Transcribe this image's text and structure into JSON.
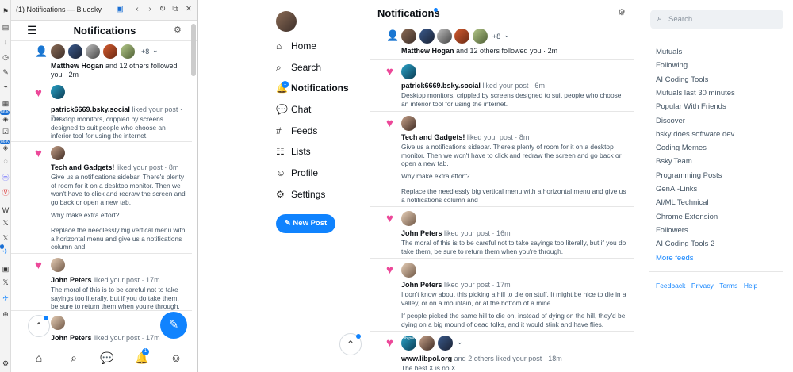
{
  "browser": {
    "tab_title": "(1) Notifications — Bluesky",
    "strip_icons": [
      "bookmark-icon",
      "book-icon",
      "download-icon",
      "clock-icon",
      "edit-icon",
      "chart-icon",
      "calendar-icon",
      "tag-icon",
      "check-icon",
      "tag-icon",
      "chat-icon",
      "mastodon-icon",
      "vivaldi-icon",
      "wikipedia-icon",
      "x-icon",
      "x-icon",
      "bluesky-icon",
      "app-icon",
      "x-icon",
      "bluesky-icon",
      "plus-icon",
      "gear-icon"
    ],
    "badge1": "86 K",
    "badge2": "86 K",
    "badge3": "1"
  },
  "panel": {
    "title": "Notifications",
    "follow_more": "+8",
    "follow_name": "Matthew Hogan",
    "follow_rest": " and 12 others followed you · 2m",
    "items": [
      {
        "name": "patrick6669.bsky.social",
        "action": " liked your post · 7m",
        "text": "Desktop monitors, crippled by screens designed to suit people who choose an inferior tool for using the internet."
      },
      {
        "name": "Tech and Gadgets!",
        "action": " liked your post · 8m",
        "text": "Give us a notifications sidebar. There's plenty of room for it on a desktop monitor. Then we won't have to click and redraw the screen and go back or open a new tab.",
        "text2": "Why make extra effort?",
        "text3": "Replace the needlessly big vertical menu with a horizontal menu and give us a notifications column and"
      },
      {
        "name": "John Peters",
        "action": " liked your post · 17m",
        "text": "The moral of this is to be careful not to take sayings too literally, but if you do take them, be sure to return them when you're through."
      },
      {
        "name": "John Peters",
        "action": " liked your post · 17m",
        "text": ""
      }
    ],
    "bottom_badge": "1"
  },
  "nav": {
    "items": [
      {
        "label": "Home",
        "icon": "home-icon"
      },
      {
        "label": "Search",
        "icon": "search-icon"
      },
      {
        "label": "Notifications",
        "icon": "bell-icon"
      },
      {
        "label": "Chat",
        "icon": "chat-icon"
      },
      {
        "label": "Feeds",
        "icon": "hash-icon"
      },
      {
        "label": "Lists",
        "icon": "list-icon"
      },
      {
        "label": "Profile",
        "icon": "profile-icon"
      },
      {
        "label": "Settings",
        "icon": "gear-icon"
      }
    ],
    "notif_badge": "1",
    "new_post": "New Post"
  },
  "feed": {
    "title": "Notifications",
    "follow_more": "+8",
    "follow_name": "Matthew Hogan",
    "follow_rest": " and 12 others followed you · 2m",
    "items": [
      {
        "name": "patrick6669.bsky.social",
        "action": " liked your post · 6m",
        "text": "Desktop monitors, crippled by screens designed to suit people who choose an inferior tool for using the internet."
      },
      {
        "name": "Tech and Gadgets!",
        "action": " liked your post · 8m",
        "text": "Give us a notifications sidebar. There's plenty of room for it on a desktop monitor. Then we won't have to click and redraw the screen and go back or open a new tab.",
        "text2": "Why make extra effort?",
        "text3": "Replace the needlessly big vertical menu with a horizontal menu and give us a notifications column and"
      },
      {
        "name": "John Peters",
        "action": " liked your post · 16m",
        "text": "The moral of this is to be careful not to take sayings too literally, but if you do take them, be sure to return them when you're through."
      },
      {
        "name": "John Peters",
        "action": " liked your post · 17m",
        "text": "I don't know about this picking a hill to die on stuff. It might be nice to die in a valley, or on a mountain, or at the bottom of a mine.",
        "text2": "If people picked the same hill to die on, instead of dying on the hill, they'd be dying on a big mound of dead folks, and it would stink and have flies."
      },
      {
        "name": "www.libpol.org",
        "action": " and 2 others liked your post · 18m",
        "text": "The best X is no X."
      }
    ],
    "libpol_avatar_text": "lib pol"
  },
  "right": {
    "search_placeholder": "Search",
    "links": [
      "Mutuals",
      "Following",
      "AI Coding Tools",
      "Mutuals last 30 minutes",
      "Popular With Friends",
      "Discover",
      "bsky does software dev",
      "Coding Memes",
      "Bsky.Team",
      "Programming Posts",
      "GenAI-Links",
      "AI/ML Technical",
      "Chrome Extension",
      "Followers",
      "AI Coding Tools 2"
    ],
    "more_feeds": "More feeds",
    "footer": [
      "Feedback",
      "Privacy",
      "Terms",
      "Help"
    ],
    "footer_sep": " · "
  }
}
